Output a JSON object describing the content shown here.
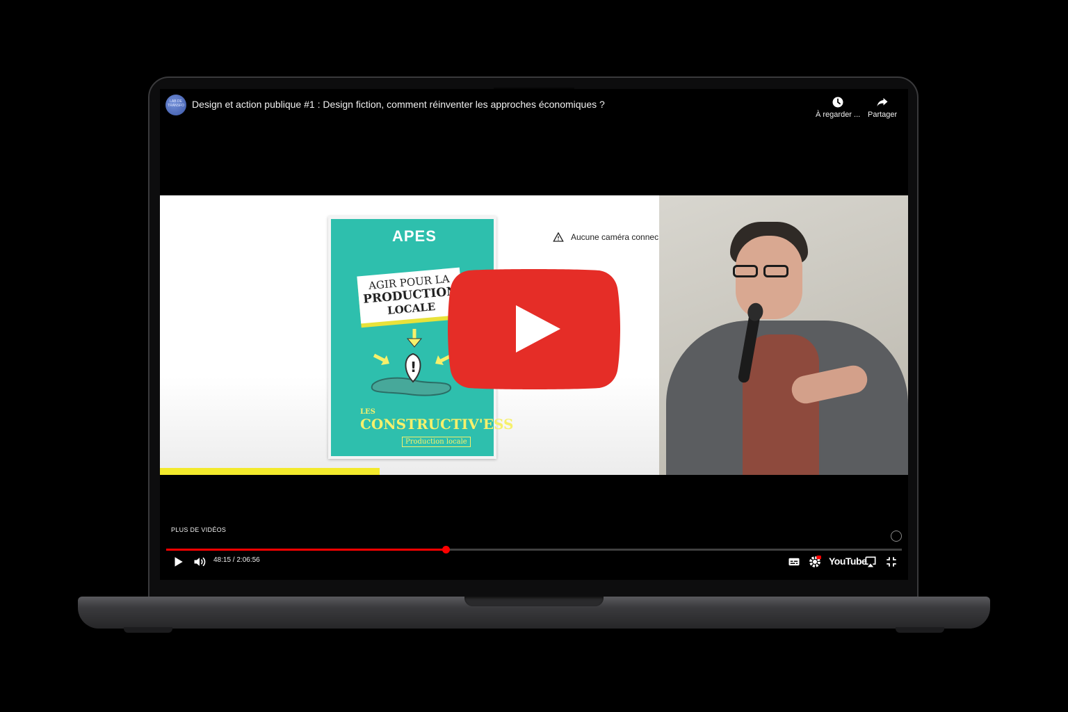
{
  "header": {
    "channel_avatar_text": "LAB DE TRANSFO",
    "title": "Design et action publique #1 : Design fiction, comment réinventer les approches économiques ?",
    "watch_later_label": "À regarder ...",
    "share_label": "Partager"
  },
  "slide": {
    "booklet": {
      "logo": "APES",
      "title_line1": "AGIR POUR LA",
      "title_line2": "PRODUCTION",
      "title_line3": "LOCALE",
      "series_prefix": "LES",
      "series_name": "CONSTRUCTIV'ESS",
      "subtitle": "Production locale"
    },
    "camera_warning": "Aucune caméra connec"
  },
  "player": {
    "more_videos_label": "PLUS DE VIDÉOS",
    "time": "48:15 / 2:06:56",
    "progress_fraction": 0.38,
    "brand": "YouTube",
    "accent_color": "#ff0000"
  },
  "icons": {
    "play": "play-icon",
    "volume": "volume-icon",
    "subtitles": "subtitles-icon",
    "settings": "settings-icon",
    "airplay": "airplay-icon",
    "exit_fullscreen": "exit-fullscreen-icon",
    "watch_later": "clock-icon",
    "share": "share-icon"
  }
}
